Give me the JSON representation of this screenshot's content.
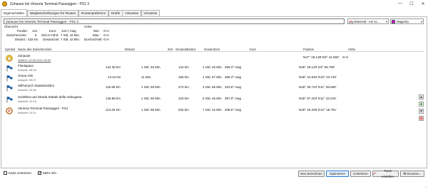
{
  "window": {
    "title": "Zuhause bis Venezia Terminal Passeggeri - PS1 3",
    "minimize": "—",
    "maximize": "☐",
    "close": "✕"
  },
  "tabs": [
    {
      "label": "Eigenschaften"
    },
    {
      "label": "Wegbeschreibungen für Routen"
    },
    {
      "label": "Routenpräferenz"
    },
    {
      "label": "Grafik"
    },
    {
      "label": "Hinweise"
    },
    {
      "label": "Verweise"
    }
  ],
  "route": {
    "name": "Zuhause bis Venezia Terminal Passeggeri - PS1 3",
    "profile": "Motorrad - Am sc...",
    "color_name": "Magenta",
    "color_hex": "#e000e0"
  },
  "overview": {
    "title": "Übersicht",
    "punkte_label": "Punkte:",
    "punkte_value": "121",
    "kurs_label": "Kurs:",
    "kurs_value": "124.7 mag",
    "zwischenziele_label": "Zwischenziele:",
    "zwischenziele_value": "6",
    "zeit_label": "Zeit in Fahrt:",
    "zeit_value": "7 Std. 42 Min.",
    "distanz_label": "Distanz:",
    "distanz_value": "532 km",
    "gesamtzeit_label": "Gesamtzeit:",
    "gesamtzeit_value": "7 Std. 42 Min."
  },
  "hoehe": {
    "title": "Höhe",
    "min_label": "Min.:",
    "min_value": "-0 m",
    "max_label": "Max.:",
    "max_value": "-0 m",
    "avg_label": "Durchschnitt:",
    "avg_value": "-0 m"
  },
  "columns": {
    "symbol": "Symbol",
    "name": "Name des Zwischenziels",
    "distanz": "Distanz",
    "zeit": "Zeit",
    "gesamtdistanz": "Gesamtdistanz",
    "gesamtzeit": "Gesamtzeit",
    "kurs": "Kurs",
    "position": "Position",
    "hoehe": "Höhe"
  },
  "waypoints": [
    {
      "icon": "home-icon",
      "name": "Zuhause",
      "sub": "Abfahrt: 15.08.2021 08:30",
      "distanz": "",
      "zeit": "",
      "gesamtdistanz": "",
      "gesamtzeit": "",
      "kurs": "",
      "position": "N47° 18.138' E8° 41.583'",
      "hoehe": "-0 m"
    },
    {
      "icon": "flag-icon",
      "name": "Flüelapass",
      "sub": "Ankunft: 09:16",
      "distanz": "142.35 km",
      "zeit": "1 Std. 46 Min.",
      "gesamtdistanz": "142 km",
      "gesamtzeit": "1 Std. 46 Min.",
      "kurs": "268.3° mag",
      "position": "N46° 45.120' E9° 56.708'",
      "hoehe": ""
    },
    {
      "icon": "flag-icon",
      "name": "Grava 106",
      "sub": "Ankunft: 09:27",
      "distanz": "13.24 km",
      "zeit": "11 Min.",
      "gesamtdistanz": "156 km",
      "gesamtzeit": "1 Std. 57 Min.",
      "kurs": "268.3° mag",
      "position": "N46° 44.940' E10° 04.740'",
      "hoehe": ""
    },
    {
      "icon": "flag-icon",
      "name": "Stilfserjoch Staatsstraße1",
      "sub": "Ankunft: 10:26",
      "distanz": "115.95 km",
      "zeit": "1 Std. 59 Min.",
      "gesamtdistanz": "272 km",
      "gesamtzeit": "3 Std. 56 Min.",
      "kurs": "323.6° mag",
      "position": "N46° 30.722' E11° 06.690'",
      "hoehe": ""
    },
    {
      "icon": "flag-icon",
      "name": "Soi30bra und Strada Statale della Valsugana",
      "sub": "Ankunft: 12:16",
      "distanz": "146.96 km",
      "zeit": "1 Std. 50 Min.",
      "gesamtdistanz": "419 km",
      "gesamtzeit": "5 Std. 46 Min.",
      "kurs": "357.9° mag",
      "position": "N45° 57.204' E11° 43.244'",
      "hoehe": ""
    },
    {
      "icon": "parking-icon",
      "name": "Venezia Terminal Passeggeri - PS1",
      "sub": "Ankunft: 14:11",
      "distanz": "113.26 km",
      "zeit": "1 Std. 55 Min.",
      "gesamtdistanz": "532 km",
      "gesamtzeit": "7 Std. 42 Min.",
      "kurs": "208.5° mag",
      "position": "N45° 26.345' E12° 18.751'",
      "hoehe": ""
    }
  ],
  "footer": {
    "karte_label": "Karte zentrieren",
    "mehr_info_label": "Mehr Info",
    "neu_berechnen": "Neu berechnen",
    "optimieren": "Optimieren",
    "umkehren": "Umkehren",
    "track_erstellen": "Track erstellen",
    "drucken": "Drucken..."
  }
}
